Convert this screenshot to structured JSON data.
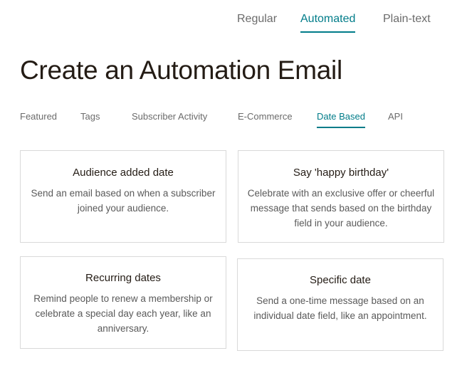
{
  "type_tabs": [
    {
      "label": "Regular",
      "active": false
    },
    {
      "label": "Automated",
      "active": true
    },
    {
      "label": "Plain-text",
      "active": false
    }
  ],
  "page_title": "Create an Automation Email",
  "category_tabs": [
    {
      "label": "Featured",
      "active": false
    },
    {
      "label": "Tags",
      "active": false
    },
    {
      "label": "Subscriber Activity",
      "active": false
    },
    {
      "label": "E-Commerce",
      "active": false
    },
    {
      "label": "Date Based",
      "active": true
    },
    {
      "label": "API",
      "active": false
    }
  ],
  "cards": [
    {
      "title": "Audience added date",
      "description": "Send an email based on when a subscriber joined your audience."
    },
    {
      "title": "Say 'happy birthday'",
      "description": "Celebrate with an exclusive offer or cheerful message that sends based on the birthday field in your audience."
    },
    {
      "title": "Recurring dates",
      "description": "Remind people to renew a membership or celebrate a special day each year, like an anniversary."
    },
    {
      "title": "Specific date",
      "description": "Send a one-time message based on an individual date field, like an appointment."
    }
  ],
  "colors": {
    "accent": "#007c89",
    "text": "#241c15",
    "muted": "#6b6b6b",
    "border": "#d9d9d9"
  }
}
